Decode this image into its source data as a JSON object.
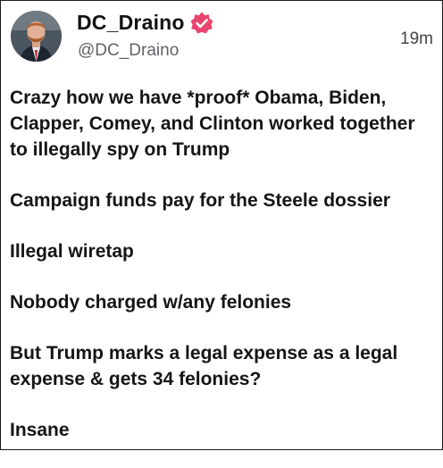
{
  "post": {
    "display_name": "DC_Draino",
    "handle": "@DC_Draino",
    "timestamp": "19m",
    "paragraphs": [
      "Crazy how we have *proof* Obama, Biden, Clapper, Comey, and Clinton worked together to illegally spy on Trump",
      "Campaign funds pay for the Steele dossier",
      "Illegal wiretap",
      "Nobody charged w/any felonies",
      "But Trump marks a legal expense as a legal expense & gets 34 felonies?",
      "Insane"
    ]
  },
  "icons": {
    "verified": "verified-badge-icon",
    "avatar": "profile-photo"
  },
  "colors": {
    "verified_badge": "#e8466f",
    "text": "#151515",
    "secondary_text": "#5f6368"
  }
}
